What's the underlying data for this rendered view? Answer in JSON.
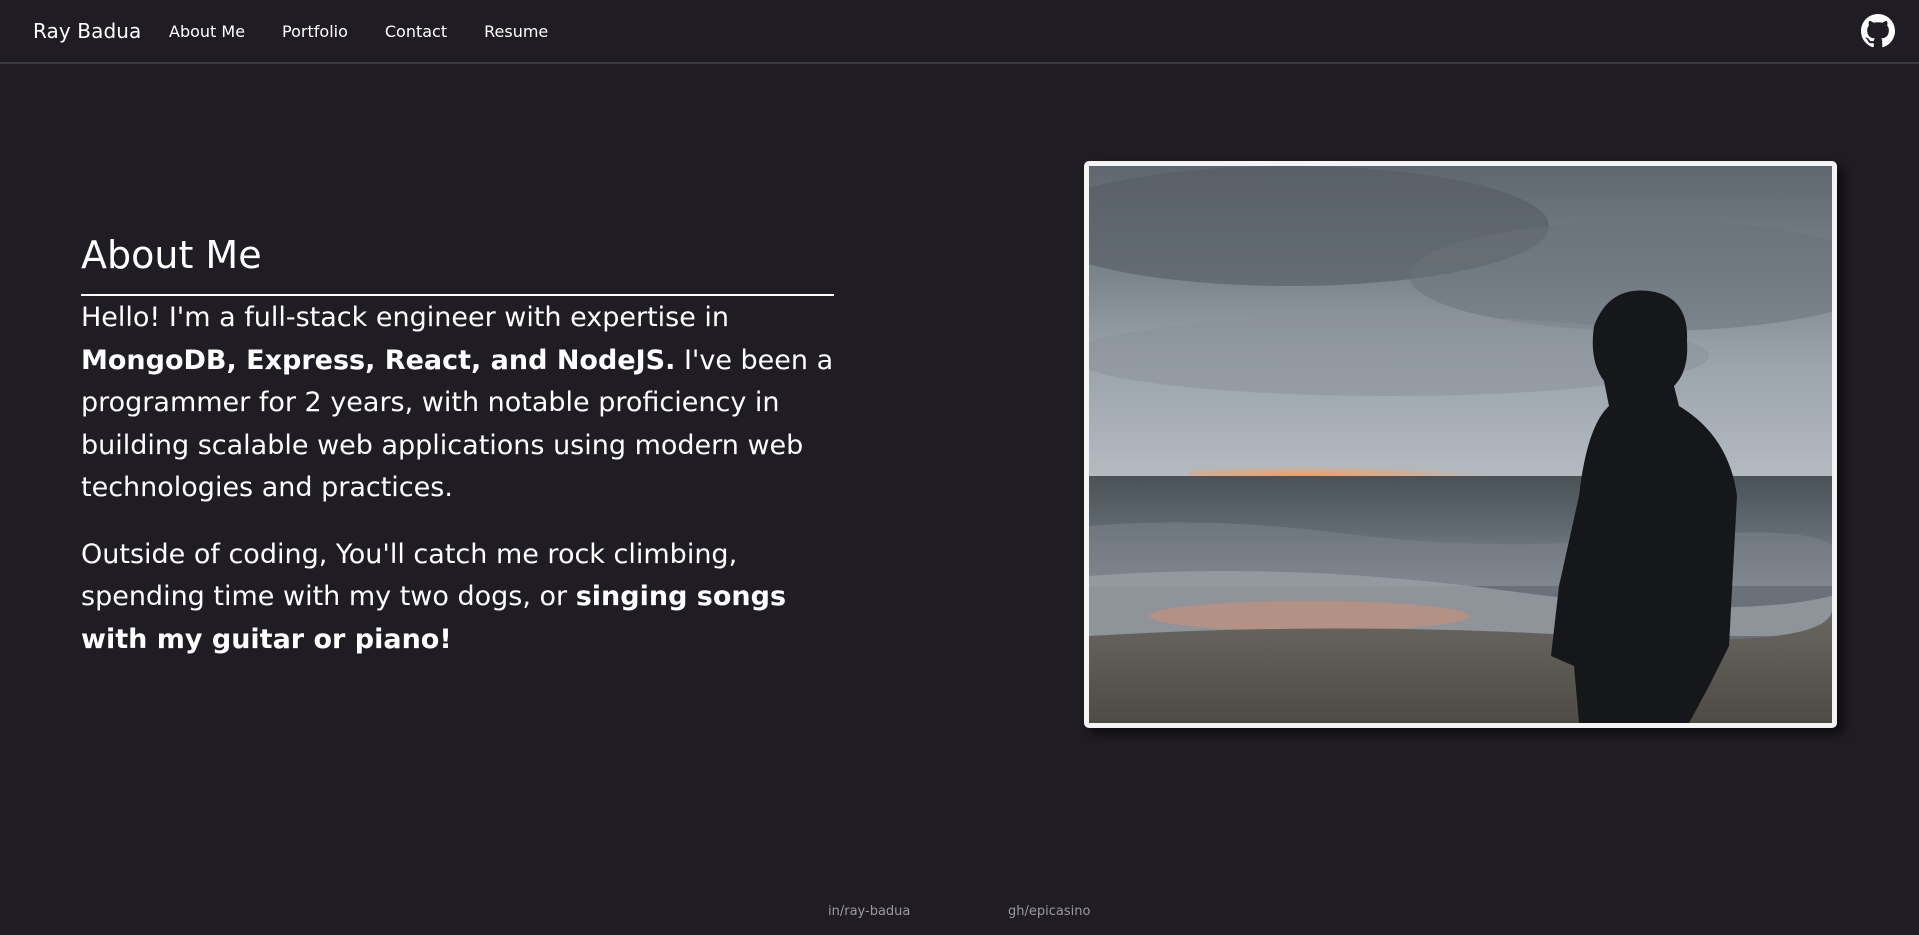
{
  "nav": {
    "brand": "Ray Badua",
    "links": [
      "About Me",
      "Portfolio",
      "Contact",
      "Resume"
    ],
    "github_icon": "github-icon"
  },
  "about": {
    "heading": "About Me",
    "p1_part1": "Hello! I'm a full-stack engineer with expertise in ",
    "p1_bold": "MongoDB, Express, React, and NodeJS.",
    "p1_part2": " I've been a programmer for 2 years, with notable proficiency in building scalable web applications using modern web technologies and practices.",
    "p2_part1": "Outside of coding, You'll catch me rock climbing, spending time with my two dogs, or ",
    "p2_bold": "singing songs with my guitar or piano!"
  },
  "footer": {
    "linkedin": "in/ray-badua",
    "github": "gh/epicasino"
  },
  "colors": {
    "background": "#1f1c24",
    "text": "#ffffff",
    "footer_text": "#9a98a0"
  }
}
